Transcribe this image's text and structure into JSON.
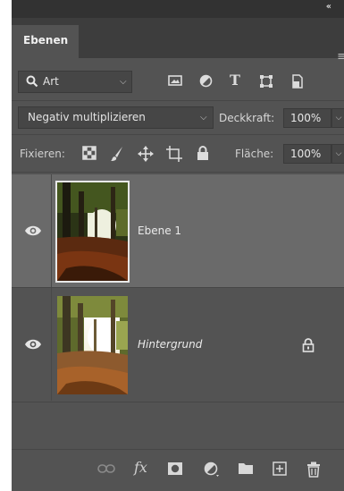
{
  "panel": {
    "collapse_glyph": "‹‹",
    "tab_label": "Ebenen",
    "menu_glyph": "≡"
  },
  "filter": {
    "kind_label": "Art",
    "icons": [
      "image-filter-icon",
      "adjustment-filter-icon",
      "type-filter-icon",
      "shape-filter-icon",
      "smart-object-filter-icon"
    ]
  },
  "blend": {
    "mode": "Negativ multiplizieren",
    "opacity_label": "Deckkraft:",
    "opacity_value": "100%"
  },
  "lock": {
    "label": "Fixieren:",
    "icons": [
      "lock-transparent-pixels-icon",
      "lock-image-pixels-icon",
      "lock-position-icon",
      "lock-artboard-icon",
      "lock-all-icon"
    ],
    "fill_label": "Fläche:",
    "fill_value": "100%"
  },
  "layers": [
    {
      "name": "Ebene 1",
      "selected": true,
      "italic": false,
      "visible": true,
      "locked": false
    },
    {
      "name": "Hintergrund",
      "selected": false,
      "italic": true,
      "visible": true,
      "locked": true
    }
  ],
  "bottom_bar": {
    "icons": [
      "link-layers-icon",
      "fx-icon",
      "mask-icon",
      "adjustment-layer-icon",
      "group-folder-icon",
      "new-layer-icon",
      "trash-icon"
    ],
    "fx_label": "fx"
  },
  "colors": {
    "panel_bg": "#535353",
    "selected_row": "#6a6a6a",
    "tab_bar": "#3d3d3d"
  }
}
